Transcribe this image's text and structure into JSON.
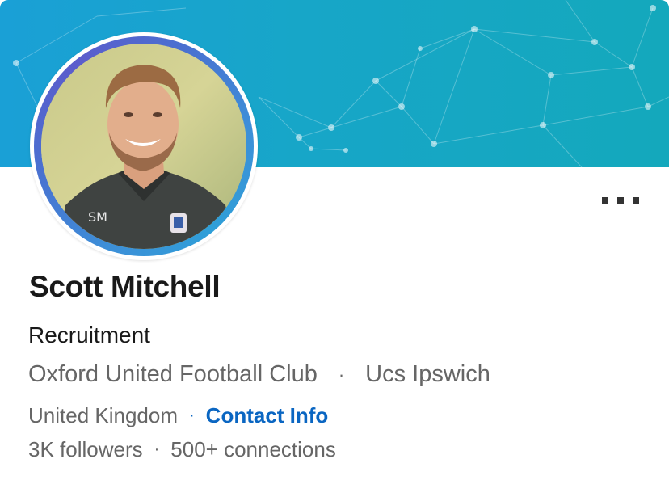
{
  "profile": {
    "name": "Scott Mitchell",
    "headline": "Recruitment",
    "current_company": "Oxford United Football Club",
    "education": "Ucs Ipswich",
    "location": "United Kingdom",
    "contact_info_label": "Contact Info",
    "followers": "3K followers",
    "connections": "500+ connections",
    "separator": "·"
  },
  "icons": {
    "more": "more-horizontal-icon"
  },
  "colors": {
    "banner": "#16a4c9",
    "link": "#0a66c2",
    "secondary_text": "#666666",
    "primary_text": "#191919"
  }
}
